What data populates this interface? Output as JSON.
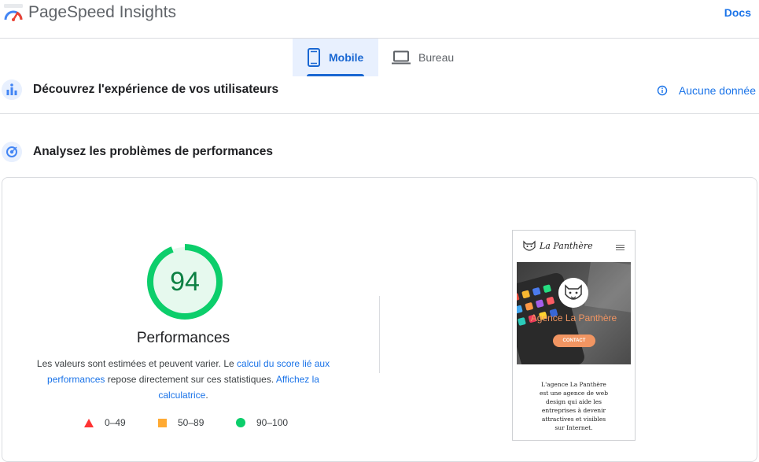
{
  "header": {
    "app_title": "PageSpeed Insights",
    "docs_label": "Docs"
  },
  "tabs": [
    {
      "label": "Mobile",
      "icon": "smartphone-icon",
      "selected": true
    },
    {
      "label": "Bureau",
      "icon": "laptop-icon",
      "selected": false
    }
  ],
  "field_data": {
    "title": "Découvrez l'expérience de vos utilisateurs",
    "no_data_label": "Aucune donnée"
  },
  "lab_data": {
    "title": "Analysez les problèmes de performances"
  },
  "performance": {
    "score": "94",
    "score_fraction": 0.94,
    "title": "Performances",
    "desc_part1": "Les valeurs sont estimées et peuvent varier. Le ",
    "desc_link1": "calcul du score lié aux performances",
    "desc_part2": " repose directement sur ces statistiques. ",
    "desc_link2": "Affichez la calculatrice",
    "desc_part3": ".",
    "legend": [
      {
        "label": "0–49",
        "shape": "triangle",
        "color": "#ff3333"
      },
      {
        "label": "50–89",
        "shape": "square",
        "color": "#ffaa33"
      },
      {
        "label": "90–100",
        "shape": "circle",
        "color": "#0cce6b"
      }
    ],
    "colors": {
      "good": "#0cce6b",
      "good_text": "#0d8043",
      "gauge_bg": "#e6f9ee"
    }
  },
  "screenshot": {
    "brand": "La Panthère",
    "hero_title": "Agence La Panthère",
    "cta": "CONTACT",
    "body_lines": [
      "L'agence La Panthère",
      "est une agence de web",
      "design qui aide les",
      "entreprises à devenir",
      "attractives et visibles",
      "sur Internet."
    ]
  }
}
